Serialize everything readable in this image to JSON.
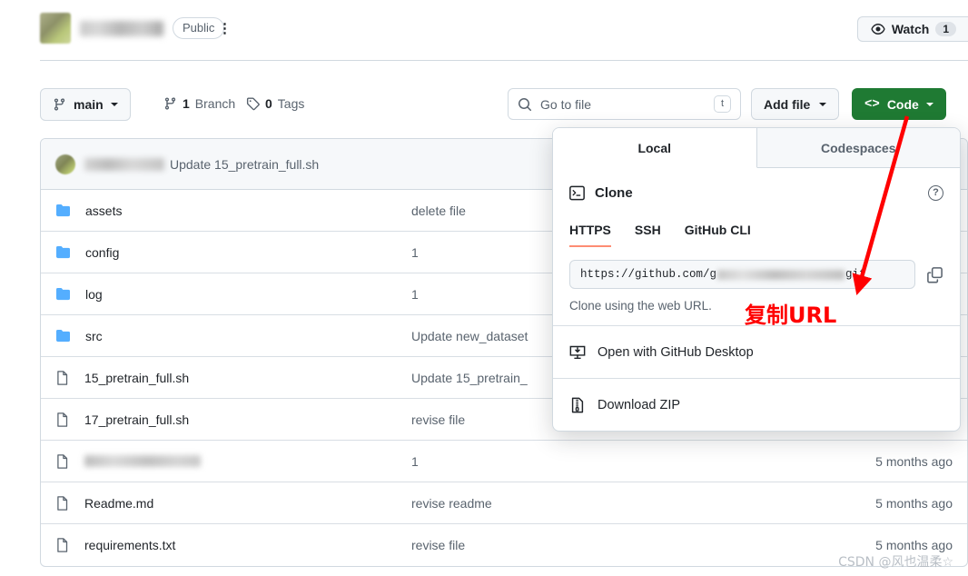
{
  "header": {
    "repo_name_redacted": true,
    "visibility_badge": "Public",
    "watch_label": "Watch",
    "watch_count": "1"
  },
  "toolbar": {
    "branch_name": "main",
    "branches_count": "1",
    "branches_label": "Branch",
    "tags_count": "0",
    "tags_label": "Tags",
    "goto_file_placeholder": "Go to file",
    "goto_file_shortcut": "t",
    "add_file_label": "Add file",
    "code_label": "Code",
    "code_button_color": "#1f7a33"
  },
  "commit_bar": {
    "author_redacted": true,
    "message": "Update 15_pretrain_full.sh"
  },
  "file_table": {
    "rows": [
      {
        "type": "folder",
        "name": "assets",
        "redacted": false,
        "message": "delete file",
        "time": ""
      },
      {
        "type": "folder",
        "name": "config",
        "redacted": false,
        "message": "1",
        "time": ""
      },
      {
        "type": "folder",
        "name": "log",
        "redacted": false,
        "message": "1",
        "time": ""
      },
      {
        "type": "folder",
        "name": "src",
        "redacted": false,
        "message": "Update new_dataset",
        "time": ""
      },
      {
        "type": "file",
        "name": "15_pretrain_full.sh",
        "redacted": false,
        "message": "Update 15_pretrain_",
        "time": ""
      },
      {
        "type": "file",
        "name": "17_pretrain_full.sh",
        "redacted": false,
        "message": "revise file",
        "time": ""
      },
      {
        "type": "file",
        "name": "",
        "redacted": true,
        "message": "1",
        "time": "5 months ago"
      },
      {
        "type": "file",
        "name": "Readme.md",
        "redacted": false,
        "message": "revise readme",
        "time": "5 months ago"
      },
      {
        "type": "file",
        "name": "requirements.txt",
        "redacted": false,
        "message": "revise file",
        "time": "5 months ago"
      }
    ]
  },
  "code_panel": {
    "tabs": [
      {
        "label": "Local",
        "active": true
      },
      {
        "label": "Codespaces",
        "active": false
      }
    ],
    "clone_title": "Clone",
    "help_glyph": "?",
    "protocol_tabs": [
      {
        "label": "HTTPS",
        "active": true
      },
      {
        "label": "SSH",
        "active": false
      },
      {
        "label": "GitHub CLI",
        "active": false
      }
    ],
    "clone_url_prefix": "https://github.com/g",
    "clone_url_suffix": "git",
    "clone_url_redacted": true,
    "clone_hint": "Clone using the web URL.",
    "items": [
      {
        "label": "Open with GitHub Desktop"
      },
      {
        "label": "Download ZIP"
      }
    ]
  },
  "annotations": {
    "copy_url_text": "复制URL",
    "annotation_color": "#ff0000",
    "watermark": "CSDN @风也温柔☆"
  }
}
